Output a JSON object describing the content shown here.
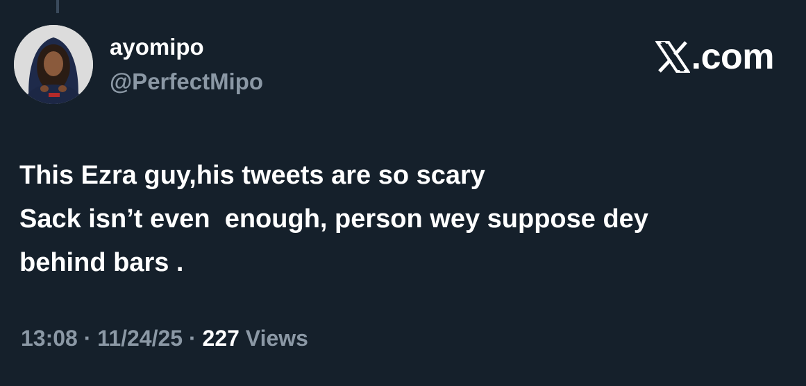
{
  "author": {
    "display_name": "ayomipo",
    "handle": "@PerfectMipo",
    "avatar_icon": "profile-photo"
  },
  "brand": {
    "icon": "x-logo-icon",
    "suffix": ".com"
  },
  "tweet": {
    "lines": [
      "This Ezra guy,his tweets are so scary",
      "Sack isn’t even  enough, person wey suppose dey",
      "behind bars ."
    ]
  },
  "meta": {
    "time": "13:08",
    "separator_1": " · ",
    "date": "11/24/25",
    "separator_2": " · ",
    "views_count": "227",
    "views_label": " Views"
  },
  "colors": {
    "background": "#15202b",
    "primary_text": "#ffffff",
    "secondary_text": "#8b98a5"
  }
}
